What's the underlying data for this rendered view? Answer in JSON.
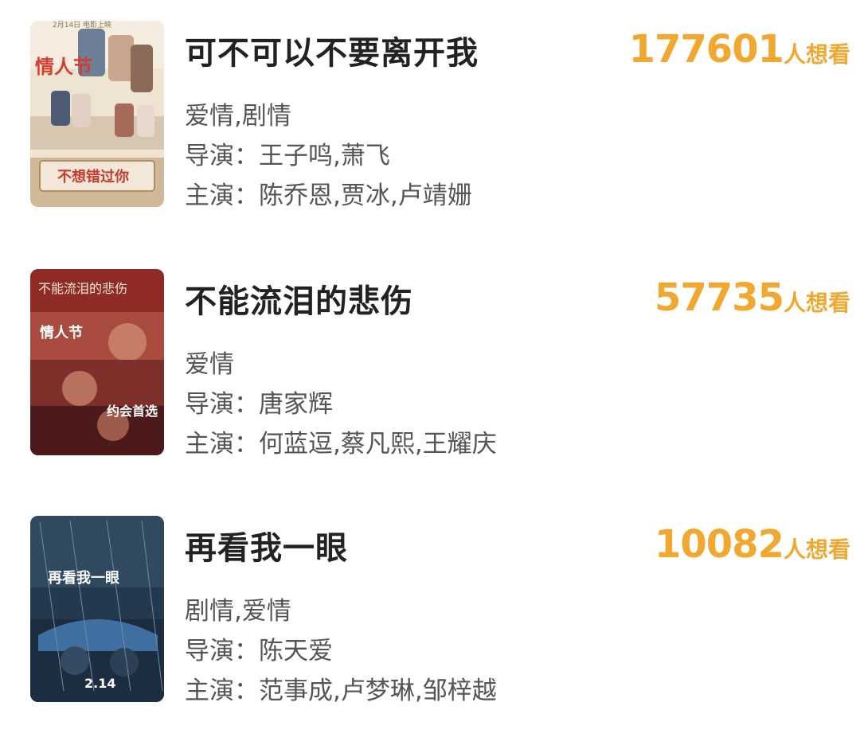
{
  "accent_color": "#f0a830",
  "movies": [
    {
      "title": "可不可以不要离开我",
      "genre": "爱情,剧情",
      "director_label": "导演：",
      "directors": "王子鸣,萧飞",
      "cast_label": "主演：",
      "cast": "陈乔恩,贾冰,卢靖姗",
      "want_count": "177601",
      "want_suffix": "人想看",
      "poster": {
        "top_label": "2月14日 电影上映",
        "text_a": "情人节",
        "text_b": "不想错过你"
      }
    },
    {
      "title": "不能流泪的悲伤",
      "genre": "爱情",
      "director_label": "导演：",
      "directors": "唐家辉",
      "cast_label": "主演：",
      "cast": "何蓝逗,蔡凡熙,王耀庆",
      "want_count": "57735",
      "want_suffix": "人想看",
      "poster": {
        "top_label": "不能流泪的悲伤",
        "text_a": "情人节",
        "text_b": "约会首选"
      }
    },
    {
      "title": "再看我一眼",
      "genre": "剧情,爱情",
      "director_label": "导演：",
      "directors": "陈天爱",
      "cast_label": "主演：",
      "cast": "范事成,卢梦琳,邹梓越",
      "want_count": "10082",
      "want_suffix": "人想看",
      "poster": {
        "text_a": "再看我一眼",
        "text_b": "2.14"
      }
    }
  ]
}
